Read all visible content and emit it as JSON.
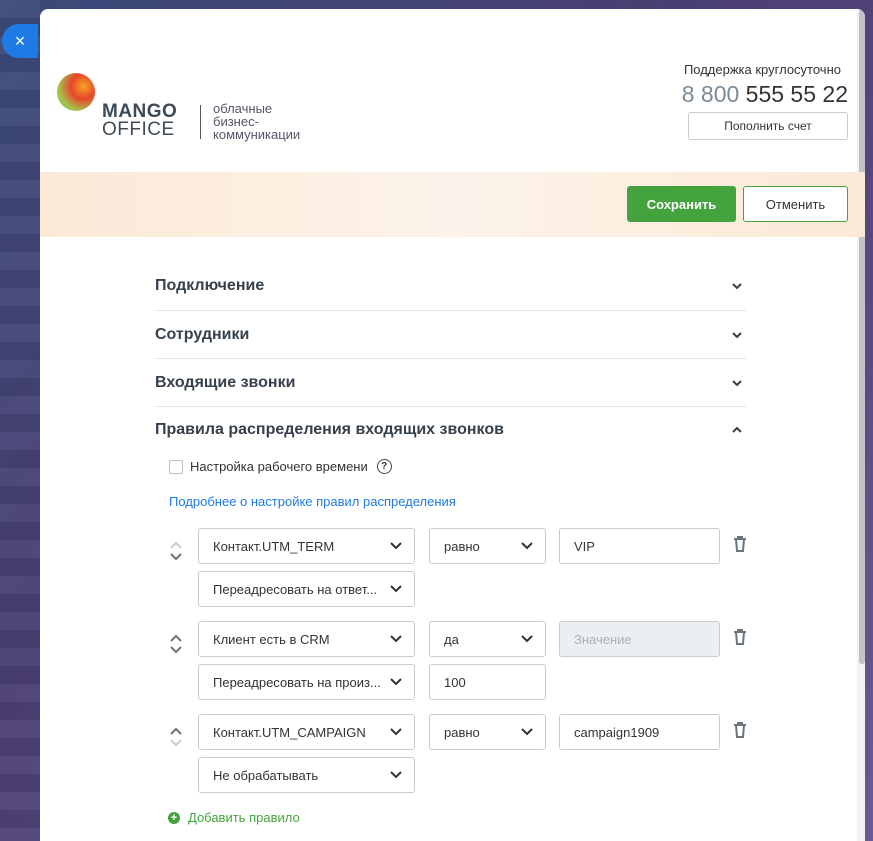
{
  "close_label": "×",
  "header": {
    "logo": {
      "line1": "MANGO",
      "line2": "OFFICE",
      "tagline": [
        "облачные",
        "бизнес-",
        "коммуникации"
      ]
    },
    "support_label": "Поддержка круглосуточно",
    "phone_prefix": "8 800",
    "phone_number": "555 55 22",
    "topup_label": "Пополнить счет"
  },
  "actions": {
    "save_label": "Сохранить",
    "cancel_label": "Отменить"
  },
  "sections": [
    {
      "label": "Подключение",
      "expanded": false
    },
    {
      "label": "Сотрудники",
      "expanded": false
    },
    {
      "label": "Входящие звонки",
      "expanded": false
    },
    {
      "label": "Правила распределения входящих звонков",
      "expanded": true
    }
  ],
  "distribution": {
    "worktime_label": "Настройка рабочего времени",
    "help_icon": "?",
    "more_link": "Подробнее о настройке правил распределения",
    "rules": [
      {
        "condition": "Контакт.UTM_TERM",
        "operator": "равно",
        "value": "VIP",
        "value_placeholder": "",
        "action": "Переадресовать на ответ...",
        "action_value": ""
      },
      {
        "condition": "Клиент есть в CRM",
        "operator": "да",
        "value": "",
        "value_placeholder": "Значение",
        "action": "Переадресовать на произ...",
        "action_value": "100"
      },
      {
        "condition": "Контакт.UTM_CAMPAIGN",
        "operator": "равно",
        "value": "campaign1909",
        "value_placeholder": "",
        "action": "Не обрабатывать",
        "action_value": ""
      }
    ],
    "add_rule_label": "Добавить правило"
  },
  "colors": {
    "accent_green": "#45a33e",
    "link_blue": "#1e7be6",
    "close_blue": "#1e7be6"
  }
}
